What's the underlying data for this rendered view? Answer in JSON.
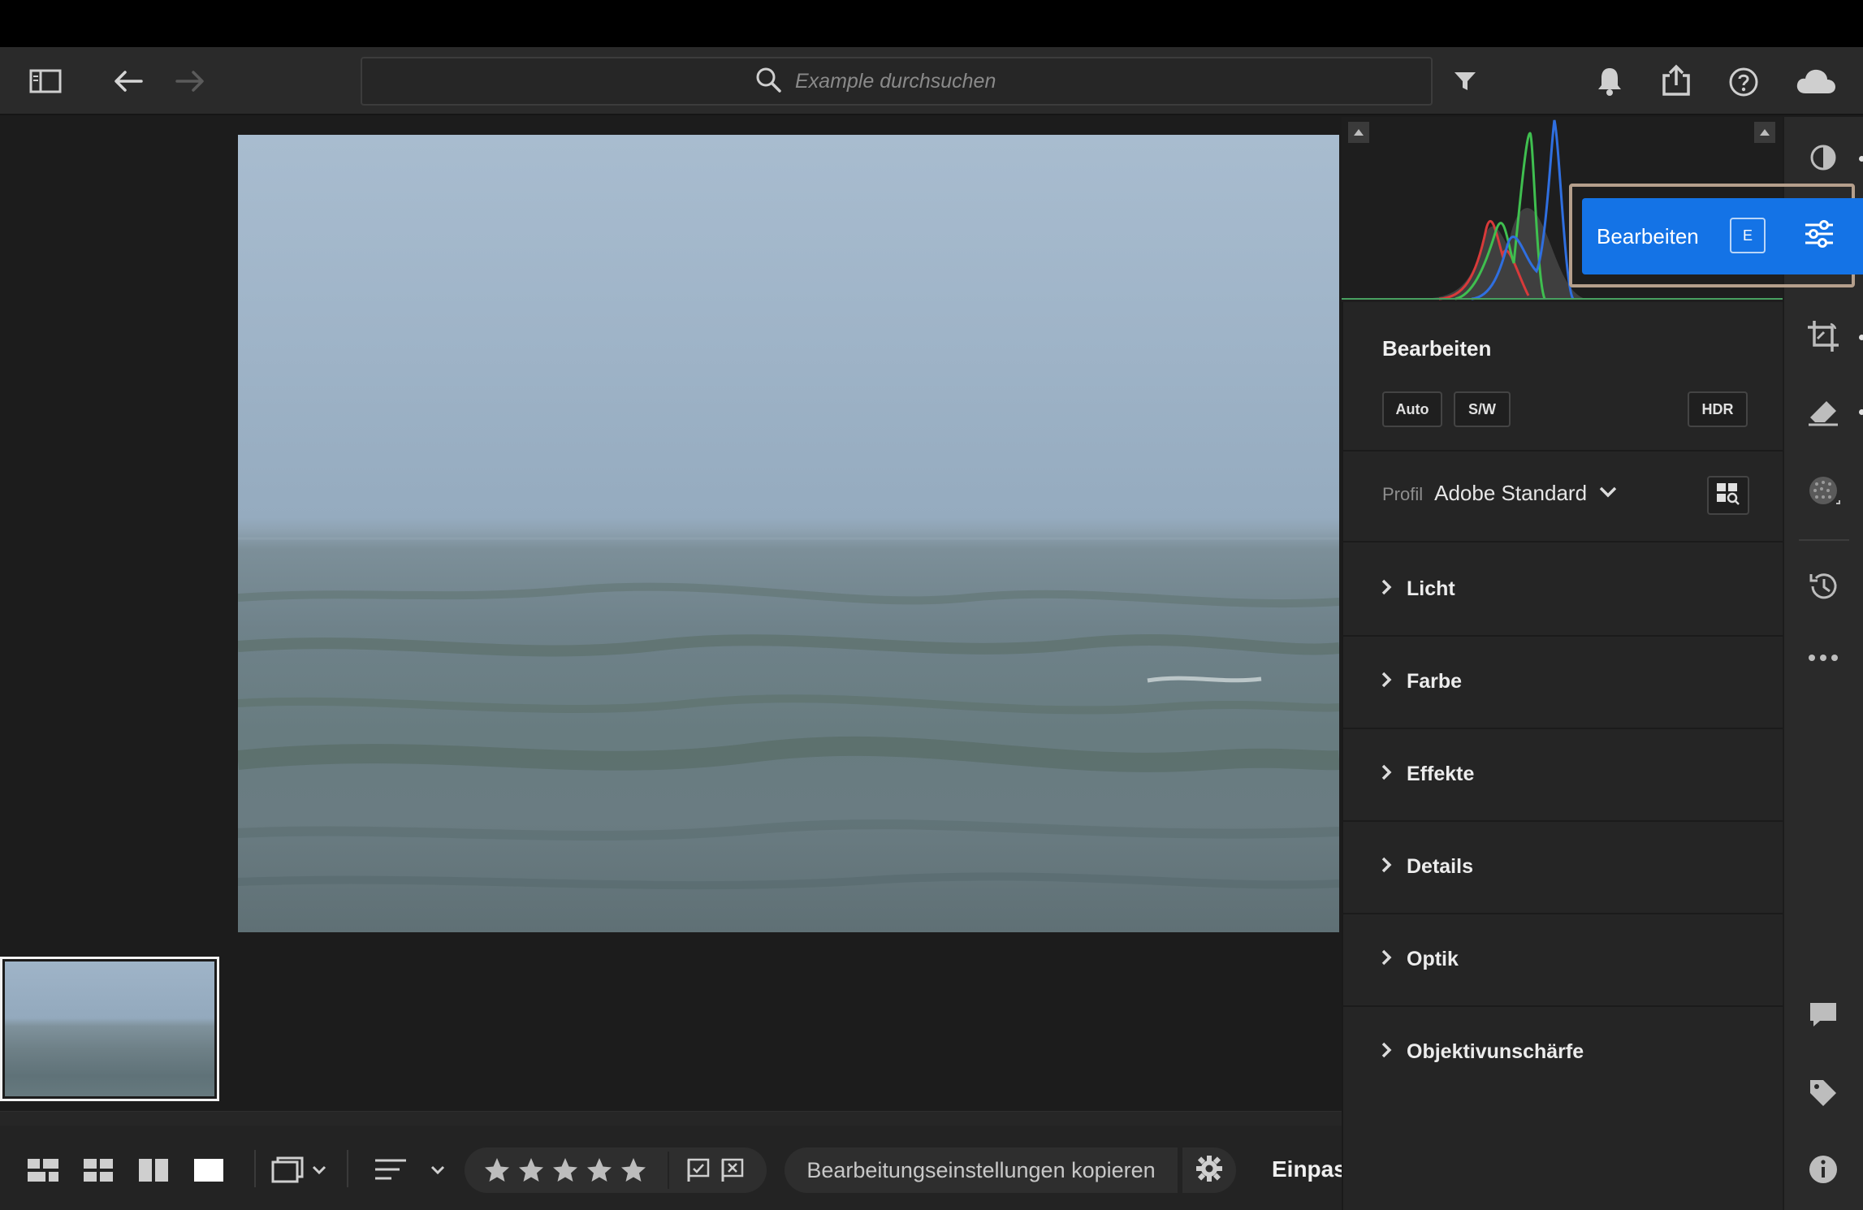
{
  "toolbar": {
    "search_placeholder": "Example durchsuchen"
  },
  "filmstrip": {
    "fit_label": "Einpas"
  },
  "bottom_bar": {
    "copy_settings_label": "Bearbeitungseinstellungen kopieren",
    "rating_stars": 5
  },
  "edit_panel": {
    "title": "Bearbeiten",
    "chips": {
      "auto": "Auto",
      "bw": "S/W",
      "hdr": "HDR"
    },
    "profile": {
      "label": "Profil",
      "value": "Adobe Standard"
    },
    "sections": [
      {
        "label": "Licht"
      },
      {
        "label": "Farbe"
      },
      {
        "label": "Effekte"
      },
      {
        "label": "Details"
      },
      {
        "label": "Optik"
      },
      {
        "label": "Objektivunschärfe"
      }
    ]
  },
  "edit_tooltip": {
    "label": "Bearbeiten",
    "shortcut": "E"
  },
  "colors": {
    "accent": "#1473e6",
    "highlight_border": "#b59f8c",
    "panel_bg": "#252525",
    "toolbar_bg": "#2a2a2a"
  },
  "icons": [
    "panel-toggle-icon",
    "back-arrow-icon",
    "forward-arrow-icon",
    "search-icon",
    "filter-icon",
    "bell-icon",
    "share-icon",
    "help-icon",
    "cloud-icon",
    "grid-large-icon",
    "grid-small-icon",
    "compare-icon",
    "single-view-icon",
    "slideshow-icon",
    "sort-icon",
    "star-icon",
    "flag-icon",
    "reject-flag-icon",
    "gear-icon",
    "edit-sliders-icon",
    "crop-icon",
    "healing-icon",
    "masking-icon",
    "history-icon",
    "more-icon",
    "comment-icon",
    "tag-icon",
    "info-icon",
    "chevron-right-icon",
    "chevron-down-icon",
    "profile-browser-icon"
  ]
}
